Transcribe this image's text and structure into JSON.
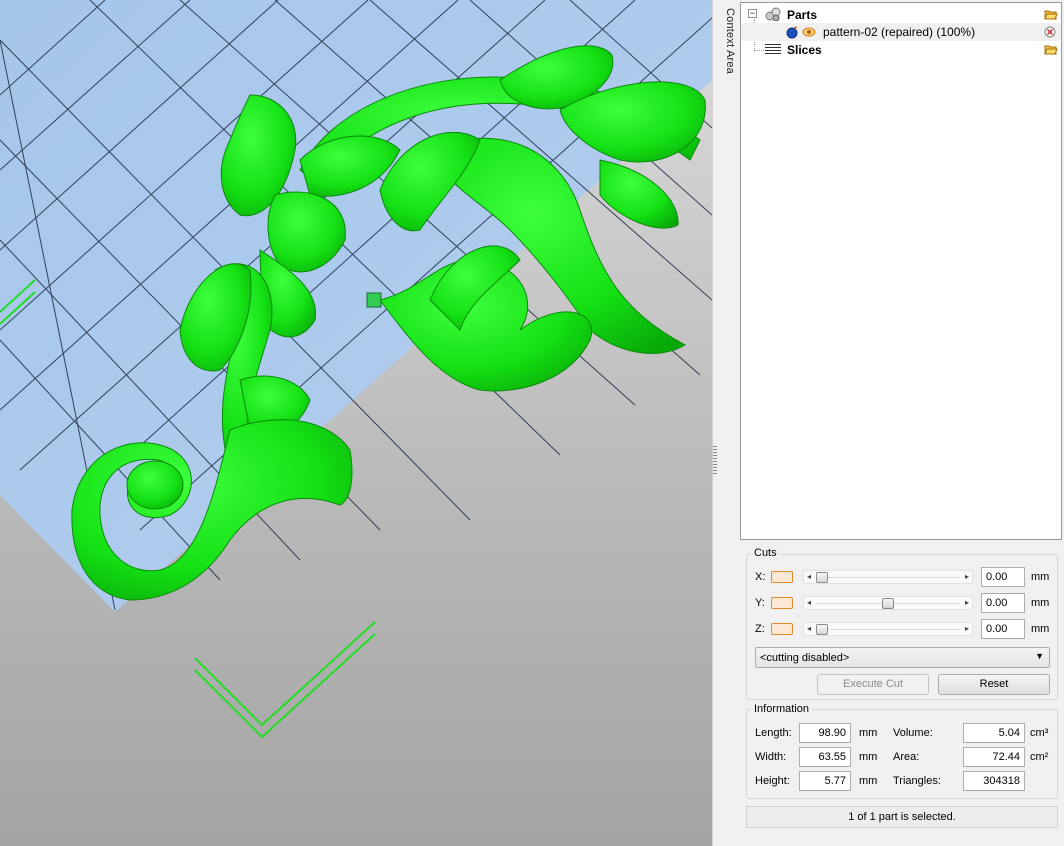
{
  "context_area_label": "Context Area",
  "tree": {
    "parts_label": "Parts",
    "part_name": "pattern-02 (repaired) (100%)",
    "slices_label": "Slices"
  },
  "cuts": {
    "title": "Cuts",
    "axes": [
      {
        "label": "X:",
        "value": "0.00",
        "unit": "mm",
        "slider_position": 0.0
      },
      {
        "label": "Y:",
        "value": "0.00",
        "unit": "mm",
        "slider_position": 0.5
      },
      {
        "label": "Z:",
        "value": "0.00",
        "unit": "mm",
        "slider_position": 0.0
      }
    ],
    "mode_select": "<cutting disabled>",
    "execute_label": "Execute Cut",
    "reset_label": "Reset"
  },
  "information": {
    "title": "Information",
    "length_label": "Length:",
    "length_value": "98.90",
    "length_unit": "mm",
    "width_label": "Width:",
    "width_value": "63.55",
    "width_unit": "mm",
    "height_label": "Height:",
    "height_value": "5.77",
    "height_unit": "mm",
    "volume_label": "Volume:",
    "volume_value": "5.04",
    "volume_unit": "cm³",
    "area_label": "Area:",
    "area_value": "72.44",
    "area_unit": "cm²",
    "triangles_label": "Triangles:",
    "triangles_value": "304318"
  },
  "status_text": "1 of 1 part is selected.",
  "colors": {
    "model": "#12e812",
    "platform": "#a8c8ec",
    "accent_orange": "#e08a2a"
  }
}
